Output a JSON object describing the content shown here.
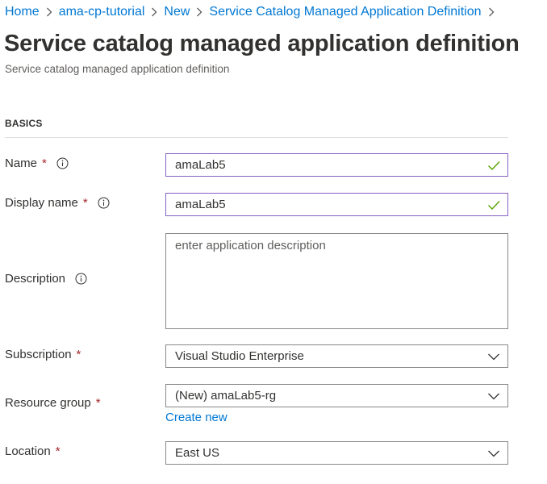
{
  "breadcrumb": [
    {
      "label": "Home"
    },
    {
      "label": "ama-cp-tutorial"
    },
    {
      "label": "New"
    },
    {
      "label": "Service Catalog Managed Application Definition"
    }
  ],
  "page": {
    "title": "Service catalog managed application definition",
    "subtitle": "Service catalog managed application definition"
  },
  "section": {
    "heading": "BASICS"
  },
  "form": {
    "name": {
      "label": "Name",
      "value": "amaLab5",
      "required": "*",
      "valid": true
    },
    "display_name": {
      "label": "Display name",
      "value": "amaLab5",
      "required": "*",
      "valid": true
    },
    "description": {
      "label": "Description",
      "value": "",
      "placeholder": "enter application description"
    },
    "subscription": {
      "label": "Subscription",
      "value": "Visual Studio Enterprise",
      "required": "*"
    },
    "resource_group": {
      "label": "Resource group",
      "value": "(New) amaLab5-rg",
      "required": "*",
      "create_new": "Create new"
    },
    "location": {
      "label": "Location",
      "value": "East US",
      "required": "*"
    }
  },
  "colors": {
    "link": "#0078d4",
    "required": "#a4262c",
    "valid_border": "#8661c5",
    "valid_check": "#57a300",
    "text": "#323130",
    "muted": "#605e5c"
  },
  "icons": [
    "chevron-right-icon",
    "info-icon",
    "checkmark-icon",
    "chevron-down-icon"
  ]
}
